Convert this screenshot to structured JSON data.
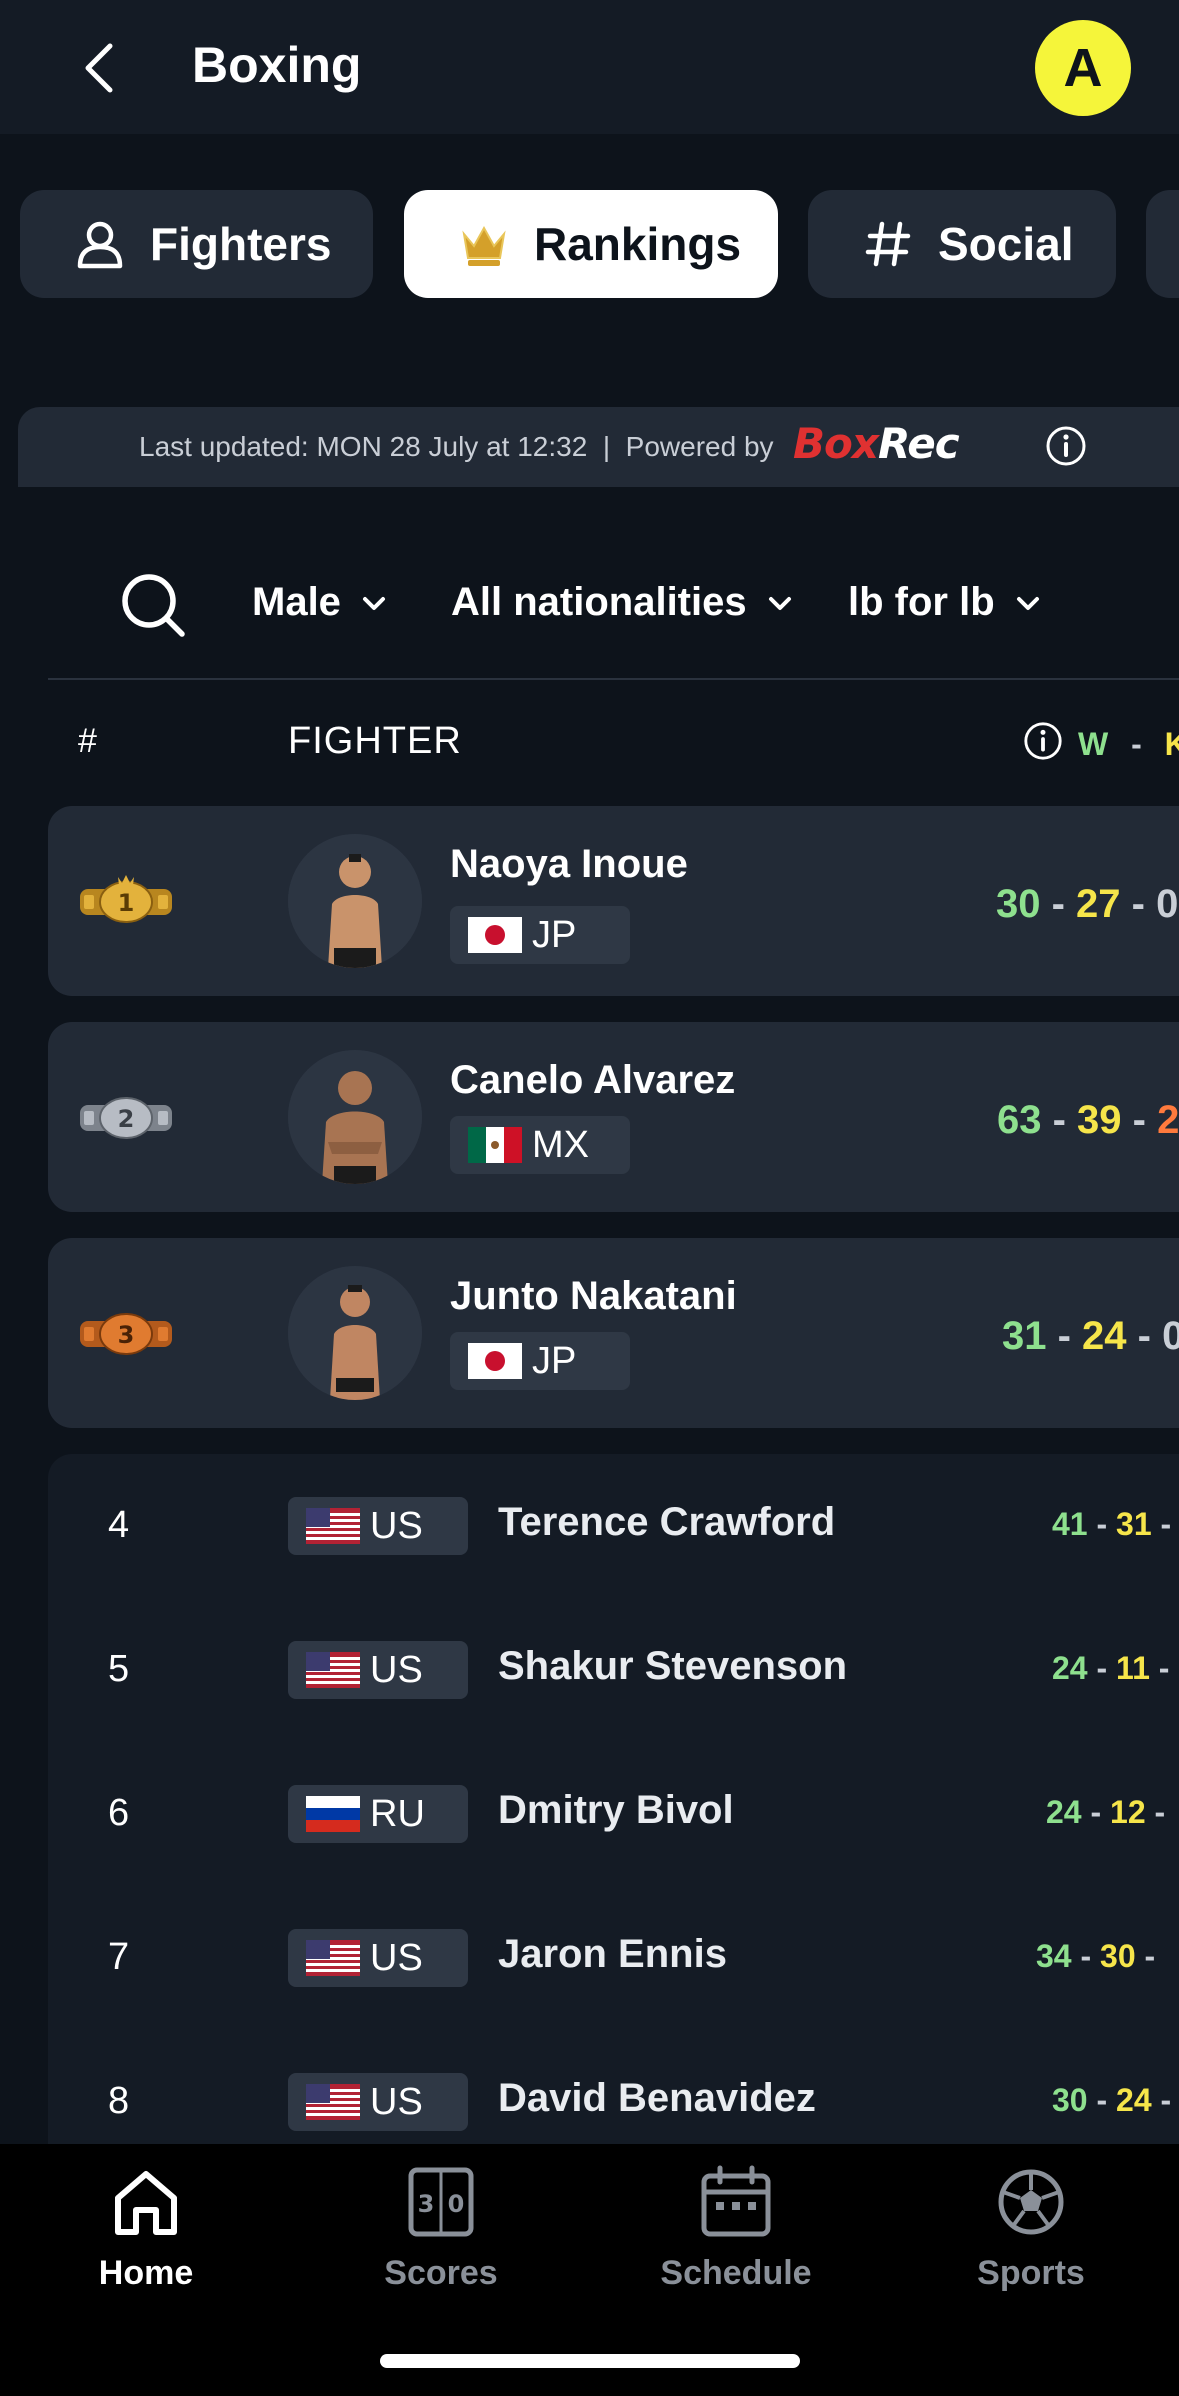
{
  "header": {
    "title": "Boxing",
    "avatar_letter": "A"
  },
  "tabs": [
    {
      "label": "Fighters",
      "icon": "person-icon",
      "active": false
    },
    {
      "label": "Rankings",
      "icon": "crown-icon",
      "active": true
    },
    {
      "label": "Social",
      "icon": "hash-icon",
      "active": false
    }
  ],
  "info": {
    "last_updated": "Last updated: MON 28 July at 12:32  |  Powered by",
    "brand_part1": "Box",
    "brand_part2": "Rec"
  },
  "filters": {
    "gender": "Male",
    "nationality": "All nationalities",
    "division": "lb for lb"
  },
  "table_header": {
    "rank": "#",
    "fighter": "FIGHTER",
    "w": "W",
    "dash": "-",
    "k": "K"
  },
  "colors": {
    "wins": "#8ee08e",
    "kos": "#f6e54a",
    "losses": "#ff7a3d",
    "gold": "#d4a02a",
    "silver": "#a6abb3",
    "bronze": "#d6712b"
  },
  "top3": [
    {
      "rank_badge": "1st",
      "name": "Naoya Inoue",
      "country": "JP",
      "flag": "jp",
      "wins": "30",
      "kos": "27",
      "losses": "0"
    },
    {
      "rank_badge": "2nd",
      "name": "Canelo Alvarez",
      "country": "MX",
      "flag": "mx",
      "wins": "63",
      "kos": "39",
      "losses": "2"
    },
    {
      "rank_badge": "3rd",
      "name": "Junto Nakatani",
      "country": "JP",
      "flag": "jp",
      "wins": "31",
      "kos": "24",
      "losses": "0"
    }
  ],
  "rows": [
    {
      "rank": "4",
      "country": "US",
      "flag": "us",
      "name": "Terence Crawford",
      "wins": "41",
      "kos": "31"
    },
    {
      "rank": "5",
      "country": "US",
      "flag": "us",
      "name": "Shakur Stevenson",
      "wins": "24",
      "kos": "11"
    },
    {
      "rank": "6",
      "country": "RU",
      "flag": "ru",
      "name": "Dmitry Bivol",
      "wins": "24",
      "kos": "12"
    },
    {
      "rank": "7",
      "country": "US",
      "flag": "us",
      "name": "Jaron Ennis",
      "wins": "34",
      "kos": "30"
    },
    {
      "rank": "8",
      "country": "US",
      "flag": "us",
      "name": "David Benavidez",
      "wins": "30",
      "kos": "24"
    }
  ],
  "nav": [
    {
      "label": "Home",
      "icon": "home-icon",
      "active": true
    },
    {
      "label": "Scores",
      "icon": "scoreboard-icon",
      "active": false
    },
    {
      "label": "Schedule",
      "icon": "calendar-icon",
      "active": false
    },
    {
      "label": "Sports",
      "icon": "soccer-ball-icon",
      "active": false
    }
  ]
}
